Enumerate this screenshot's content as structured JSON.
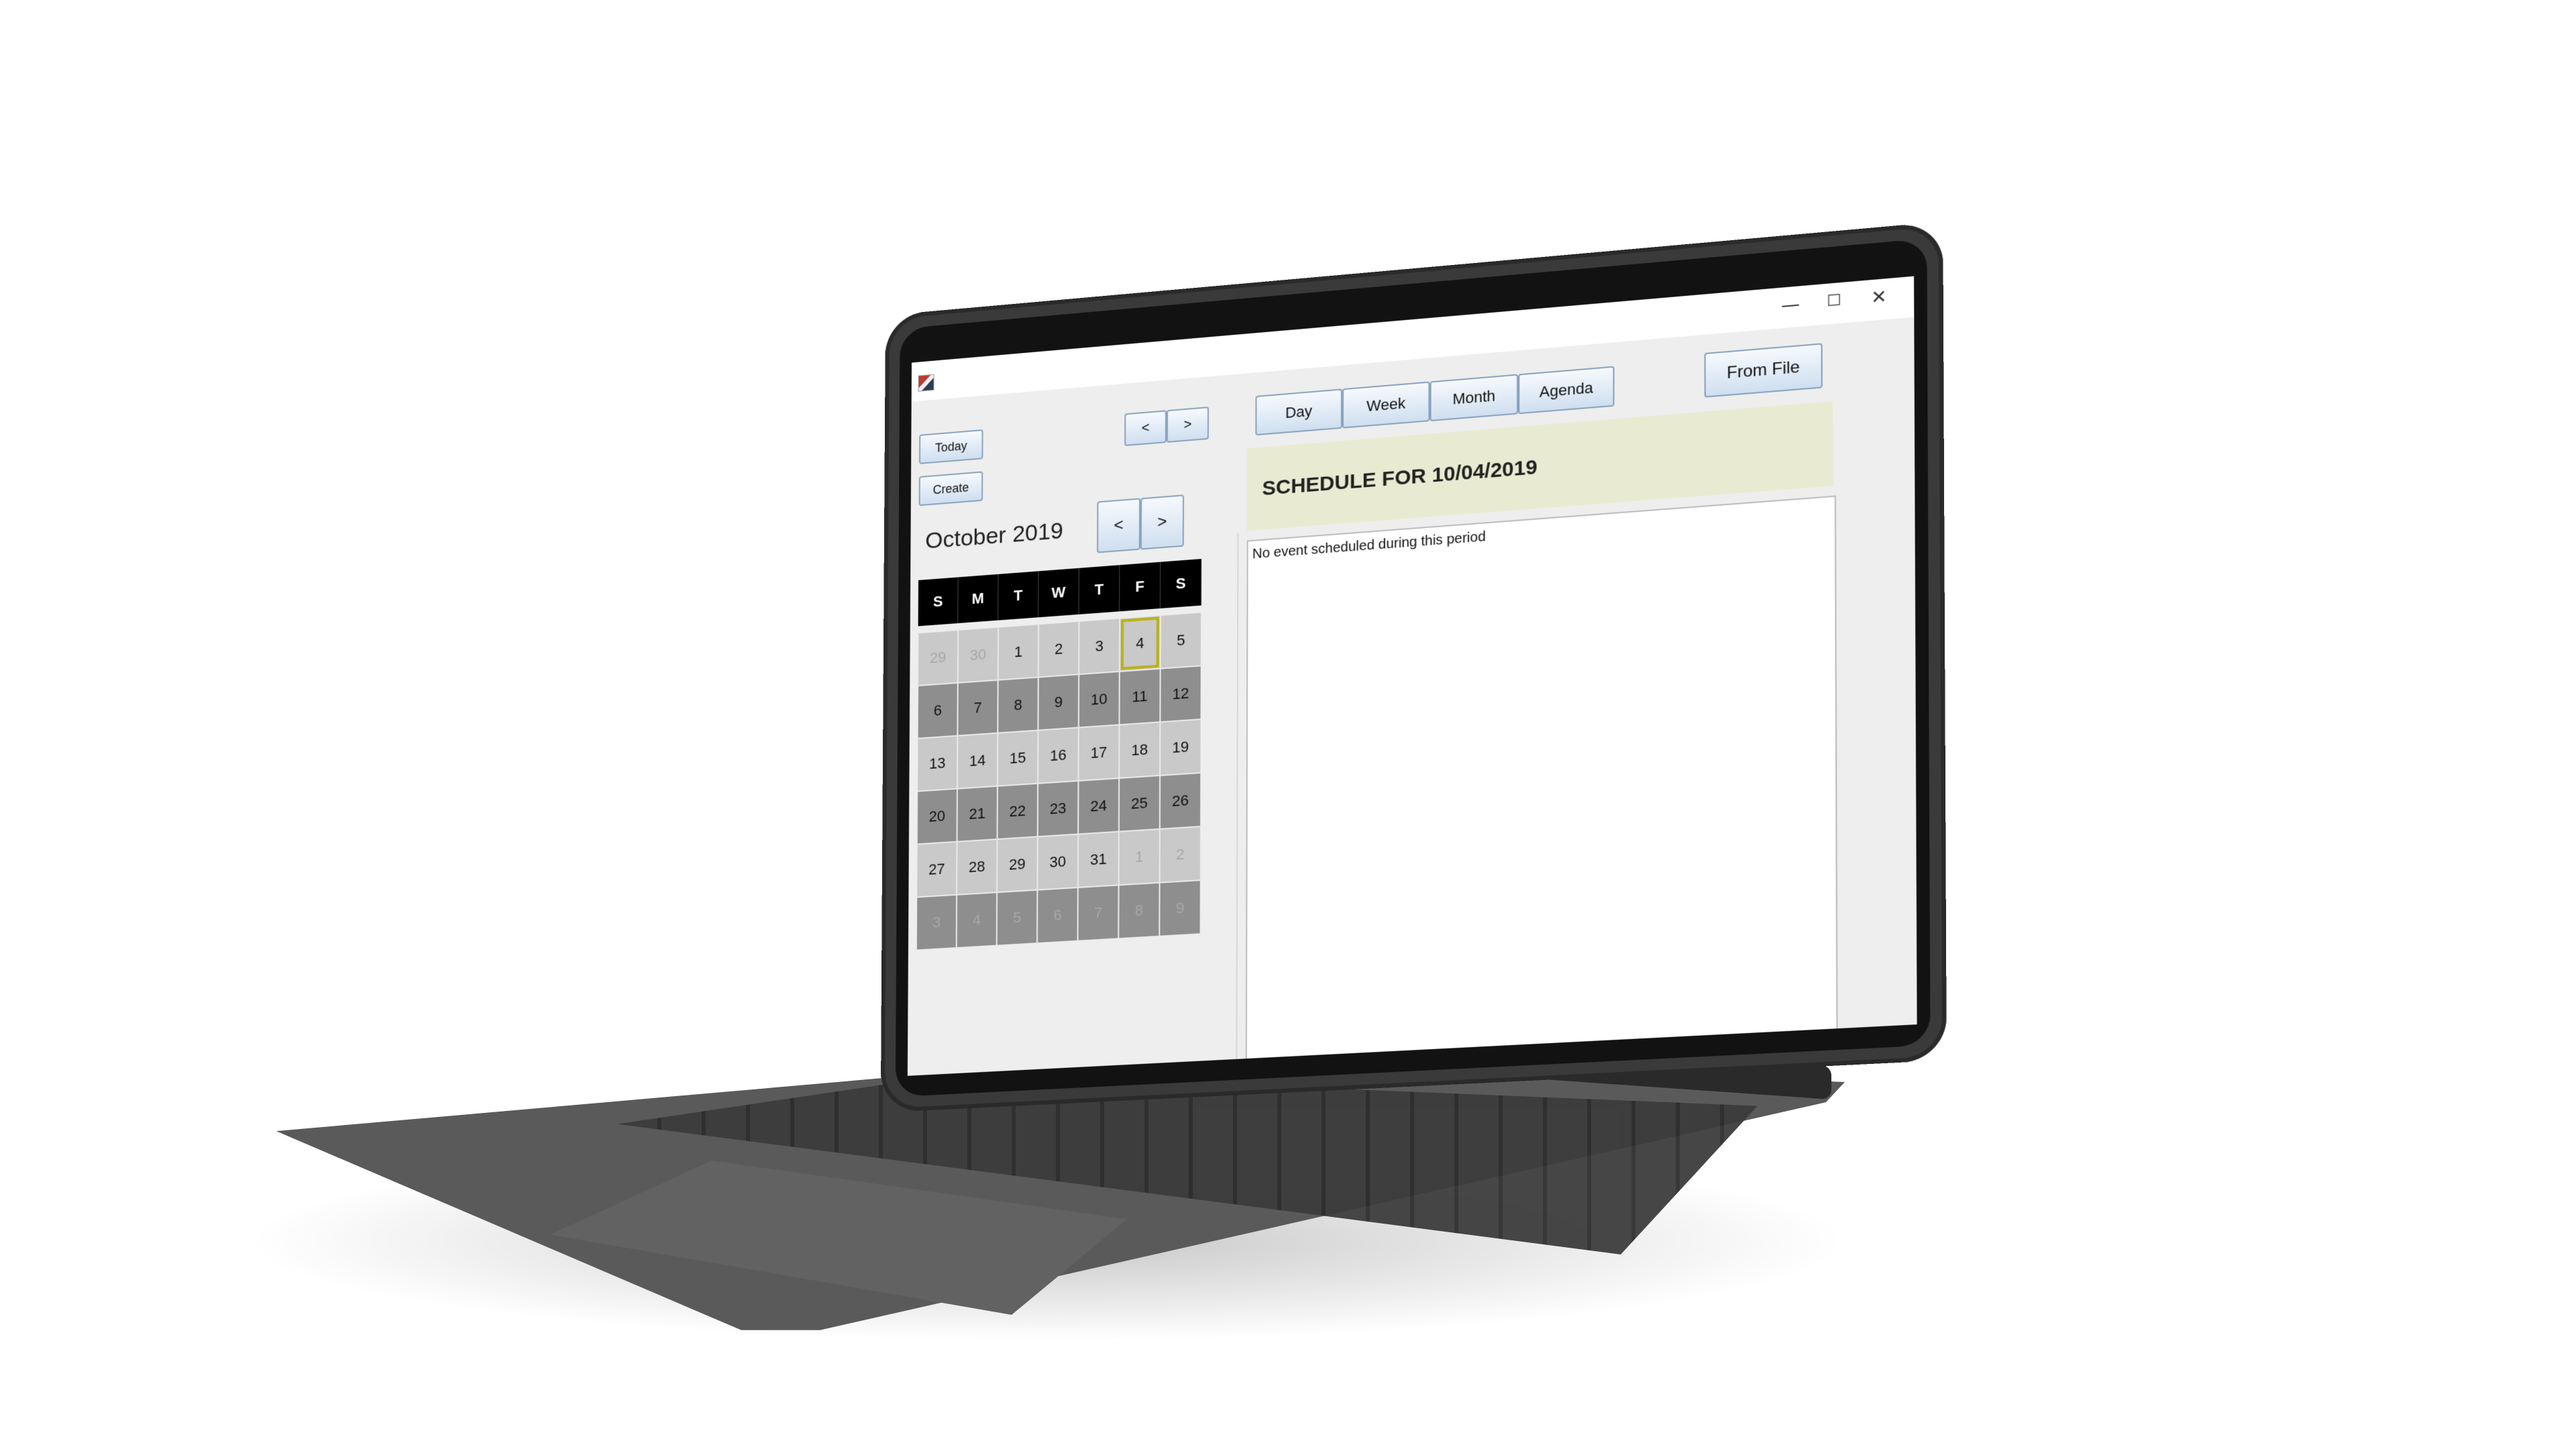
{
  "window": {
    "controls": {
      "minimize": "—",
      "maximize": "☐",
      "close": "✕"
    }
  },
  "nav": {
    "today_label": "Today",
    "create_label": "Create",
    "prev_label": "<",
    "next_label": ">"
  },
  "views": {
    "day": "Day",
    "week": "Week",
    "month": "Month",
    "agenda": "Agenda",
    "from_file": "From File"
  },
  "calendar": {
    "month_title": "October 2019",
    "prev_label": "<",
    "next_label": ">",
    "weekdays": [
      "S",
      "M",
      "T",
      "W",
      "T",
      "F",
      "S"
    ],
    "weeks": [
      [
        "29",
        "30",
        "1",
        "2",
        "3",
        "4",
        "5"
      ],
      [
        "6",
        "7",
        "8",
        "9",
        "10",
        "11",
        "12"
      ],
      [
        "13",
        "14",
        "15",
        "16",
        "17",
        "18",
        "19"
      ],
      [
        "20",
        "21",
        "22",
        "23",
        "24",
        "25",
        "26"
      ],
      [
        "27",
        "28",
        "29",
        "30",
        "31",
        "1",
        "2"
      ],
      [
        "3",
        "4",
        "5",
        "6",
        "7",
        "8",
        "9"
      ]
    ],
    "selected_day": "4"
  },
  "schedule": {
    "title": "SCHEDULE  FOR 10/04/2019",
    "empty_message": "No event scheduled during this period"
  },
  "colors": {
    "banner": "#e8ebd1",
    "selected_outline": "#b9b21a",
    "button_border": "#8aa2bf"
  }
}
